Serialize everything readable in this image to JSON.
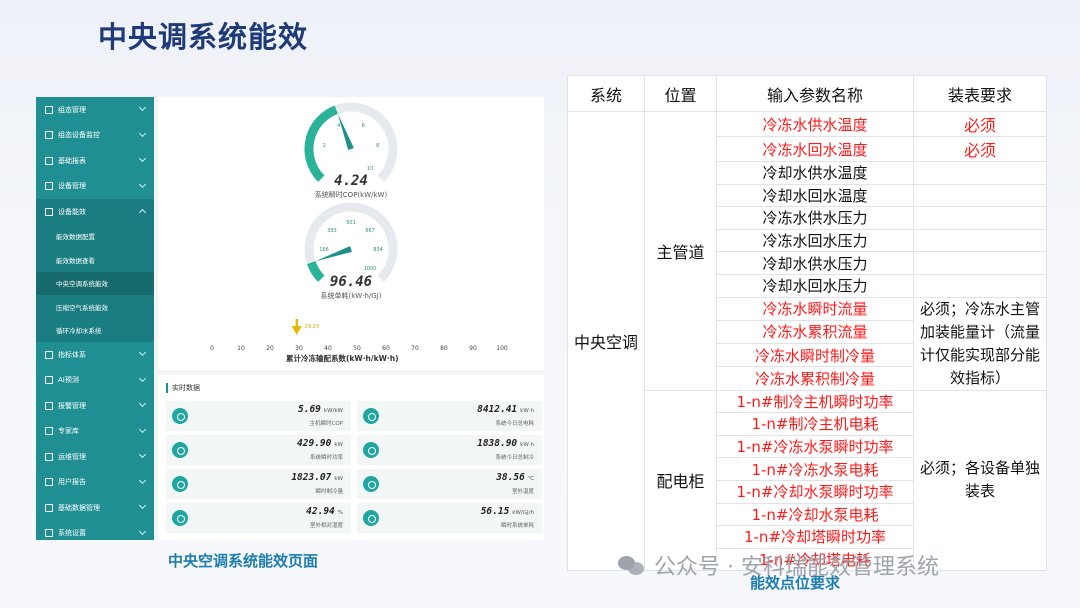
{
  "slide": {
    "title": "中央调系统能效",
    "caption_left": "中央空调系统能效页面",
    "caption_right": "能效点位要求",
    "watermark": "公众号 · 安科瑞能效管理系统"
  },
  "sidebar": {
    "items": [
      {
        "label": "组态管理",
        "icon": "layout-icon"
      },
      {
        "label": "组态设备监控",
        "icon": "monitor-icon"
      },
      {
        "label": "基础报表",
        "icon": "report-icon"
      },
      {
        "label": "设备管理",
        "icon": "device-icon"
      },
      {
        "label": "设备能效",
        "icon": "chart-icon",
        "open": true
      },
      {
        "label": "指标体系",
        "icon": "edit-icon"
      },
      {
        "label": "AI预测",
        "icon": "ai-icon"
      },
      {
        "label": "报警管理",
        "icon": "alarm-icon"
      },
      {
        "label": "专家库",
        "icon": "library-icon"
      },
      {
        "label": "运维管理",
        "icon": "ops-icon"
      },
      {
        "label": "用户报告",
        "icon": "user-report-icon"
      },
      {
        "label": "基础数据管理",
        "icon": "data-icon"
      },
      {
        "label": "系统设置",
        "icon": "settings-icon"
      }
    ],
    "subitems": [
      {
        "label": "能效数据配置"
      },
      {
        "label": "能效数据查看"
      },
      {
        "label": "中央空调系统能效",
        "active": true
      },
      {
        "label": "压缩空气系统能效"
      },
      {
        "label": "循环冷却水系统"
      }
    ]
  },
  "gauges": {
    "cop": {
      "value": "4.24",
      "caption": "系统瞬时COP(kW/kW)",
      "ticks": [
        "2",
        "4",
        "6",
        "8",
        "10"
      ],
      "min": 0,
      "max": 10,
      "reading": 4.24,
      "color": "#2bb39a"
    },
    "power": {
      "value": "96.46",
      "caption": "系统单耗(kW·h/GJ)",
      "ticks": [
        "166",
        "333",
        "501",
        "667",
        "834",
        "1000"
      ],
      "min": 0,
      "max": 1000,
      "reading": 96.46,
      "color": "#2bb39a"
    },
    "ratio": {
      "pointer_label": "29.23",
      "reading": 29.23,
      "ticks": [
        "0",
        "10",
        "20",
        "30",
        "40",
        "50",
        "60",
        "70",
        "80",
        "90",
        "100"
      ],
      "caption": "累计冷冻输配系数(kW·h/kW·h)"
    }
  },
  "realtime": {
    "title": "实时数据",
    "cells": [
      {
        "value": "5.69",
        "unit": "kW/kW",
        "label": "主机瞬时COP",
        "icon": "cop-icon"
      },
      {
        "value": "8412.41",
        "unit": "kW·h",
        "label": "系统今日总电耗",
        "icon": "energy-icon"
      },
      {
        "value": "429.90",
        "unit": "kW",
        "label": "系统瞬时功率",
        "icon": "power-icon"
      },
      {
        "value": "1838.90",
        "unit": "kW·h",
        "label": "系统今日总制冷",
        "icon": "cooling-icon"
      },
      {
        "value": "1823.07",
        "unit": "kW",
        "label": "瞬时制冷量",
        "icon": "chiller-icon"
      },
      {
        "value": "38.56",
        "unit": "℃",
        "label": "室外温度",
        "icon": "thermometer-icon"
      },
      {
        "value": "42.94",
        "unit": "%",
        "label": "室外相对湿度",
        "icon": "humidity-icon"
      },
      {
        "value": "56.15",
        "unit": "kW/GJ/h",
        "label": "瞬时系统单耗",
        "icon": "consumption-icon"
      }
    ]
  },
  "table": {
    "headers": [
      "系统",
      "位置",
      "输入参数名称",
      "装表要求"
    ],
    "system": "中央空调",
    "groups": [
      {
        "position": "主管道",
        "rows": [
          {
            "param": "冷冻水供水温度",
            "red": true
          },
          {
            "param": "冷冻水回水温度",
            "red": true
          },
          {
            "param": "冷却水供水温度",
            "red": false
          },
          {
            "param": "冷却水回水温度",
            "red": false
          },
          {
            "param": "冷冻水供水压力",
            "red": false
          },
          {
            "param": "冷冻水回水压力",
            "red": false
          },
          {
            "param": "冷却水供水压力",
            "red": false
          },
          {
            "param": "冷却水回水压力",
            "red": false
          },
          {
            "param": "冷冻水瞬时流量",
            "red": true
          },
          {
            "param": "冷冻水累积流量",
            "red": true
          },
          {
            "param": "冷冻水瞬时制冷量",
            "red": true
          },
          {
            "param": "冷冻水累积制冷量",
            "red": true
          }
        ]
      },
      {
        "position": "配电柜",
        "rows": [
          {
            "param": "1-n#制冷主机瞬时功率",
            "red": true
          },
          {
            "param": "1-n#制冷主机电耗",
            "red": true
          },
          {
            "param": "1-n#冷冻水泵瞬时功率",
            "red": true
          },
          {
            "param": "1-n#冷冻水泵电耗",
            "red": true
          },
          {
            "param": "1-n#冷却水泵瞬时功率",
            "red": true
          },
          {
            "param": "1-n#冷却水泵电耗",
            "red": true
          },
          {
            "param": "1-n#冷却塔瞬时功率",
            "red": true
          },
          {
            "param": "1-n#冷却塔电耗",
            "red": true
          }
        ]
      }
    ],
    "requirements": {
      "required": "必须",
      "flow_note": "必须；冷冻水主管加装能量计（流量计仅能实现部分能效指标）",
      "panel_note": "必须；各设备单独装表"
    }
  }
}
